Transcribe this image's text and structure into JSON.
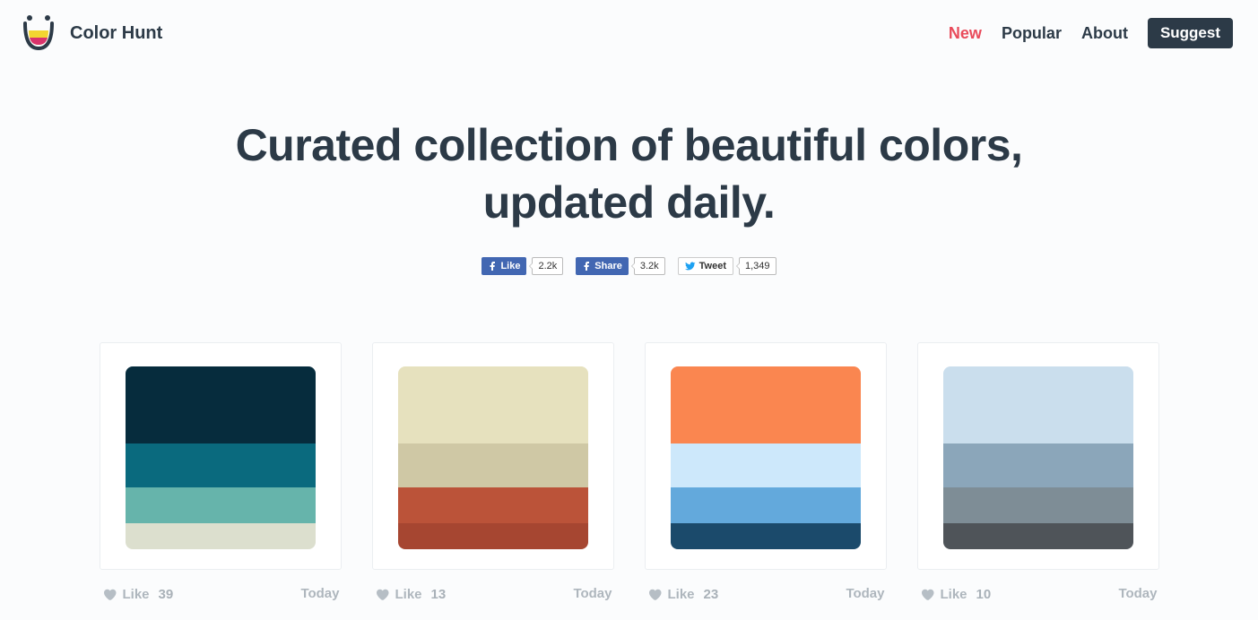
{
  "brand": {
    "name": "Color Hunt"
  },
  "nav": {
    "new": "New",
    "popular": "Popular",
    "about": "About",
    "suggest": "Suggest"
  },
  "hero": {
    "headline": "Curated collection of beautiful colors, updated daily."
  },
  "social": {
    "fb_like_label": "Like",
    "fb_like_count": "2.2k",
    "fb_share_label": "Share",
    "fb_share_count": "3.2k",
    "tw_label": "Tweet",
    "tw_count": "1,349"
  },
  "cards": [
    {
      "colors": [
        "#062c3d",
        "#0a6a7e",
        "#66b4ab",
        "#dcdfce"
      ],
      "like_label": "Like",
      "like_count": "39",
      "date": "Today"
    },
    {
      "colors": [
        "#e6e1be",
        "#cfc8a5",
        "#bb5339",
        "#a64631"
      ],
      "like_label": "Like",
      "like_count": "13",
      "date": "Today"
    },
    {
      "colors": [
        "#fa8650",
        "#cde8fb",
        "#63a9dc",
        "#1b4a6b"
      ],
      "like_label": "Like",
      "like_count": "23",
      "date": "Today"
    },
    {
      "colors": [
        "#cadeed",
        "#8ba6ba",
        "#7e8d96",
        "#4f5459"
      ],
      "like_label": "Like",
      "like_count": "10",
      "date": "Today"
    }
  ]
}
